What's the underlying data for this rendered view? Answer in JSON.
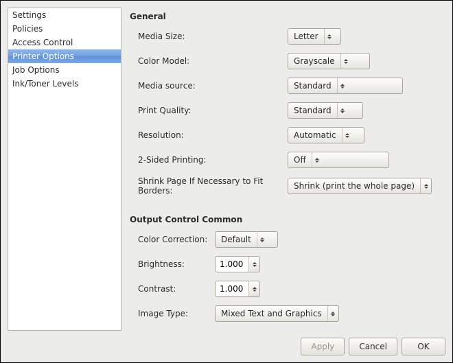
{
  "sidebar": {
    "items": [
      {
        "label": "Settings"
      },
      {
        "label": "Policies"
      },
      {
        "label": "Access Control"
      },
      {
        "label": "Printer Options"
      },
      {
        "label": "Job Options"
      },
      {
        "label": "Ink/Toner Levels"
      }
    ],
    "selected_index": 3
  },
  "general": {
    "title": "General",
    "media_size": {
      "label": "Media Size:",
      "value": "Letter"
    },
    "color_model": {
      "label": "Color Model:",
      "value": "Grayscale"
    },
    "media_source": {
      "label": "Media source:",
      "value": "Standard"
    },
    "print_quality": {
      "label": "Print Quality:",
      "value": "Standard"
    },
    "resolution": {
      "label": "Resolution:",
      "value": "Automatic"
    },
    "two_sided": {
      "label": "2-Sided Printing:",
      "value": "Off"
    },
    "shrink": {
      "label": "Shrink Page If Necessary to Fit Borders:",
      "value": "Shrink (print the whole page)"
    }
  },
  "output": {
    "title": "Output Control Common",
    "color_correction": {
      "label": "Color Correction:",
      "value": "Default"
    },
    "brightness": {
      "label": "Brightness:",
      "value": "1.000"
    },
    "contrast": {
      "label": "Contrast:",
      "value": "1.000"
    },
    "image_type": {
      "label": "Image Type:",
      "value": "Mixed Text and Graphics"
    }
  },
  "buttons": {
    "apply": "Apply",
    "cancel": "Cancel",
    "ok": "OK"
  }
}
